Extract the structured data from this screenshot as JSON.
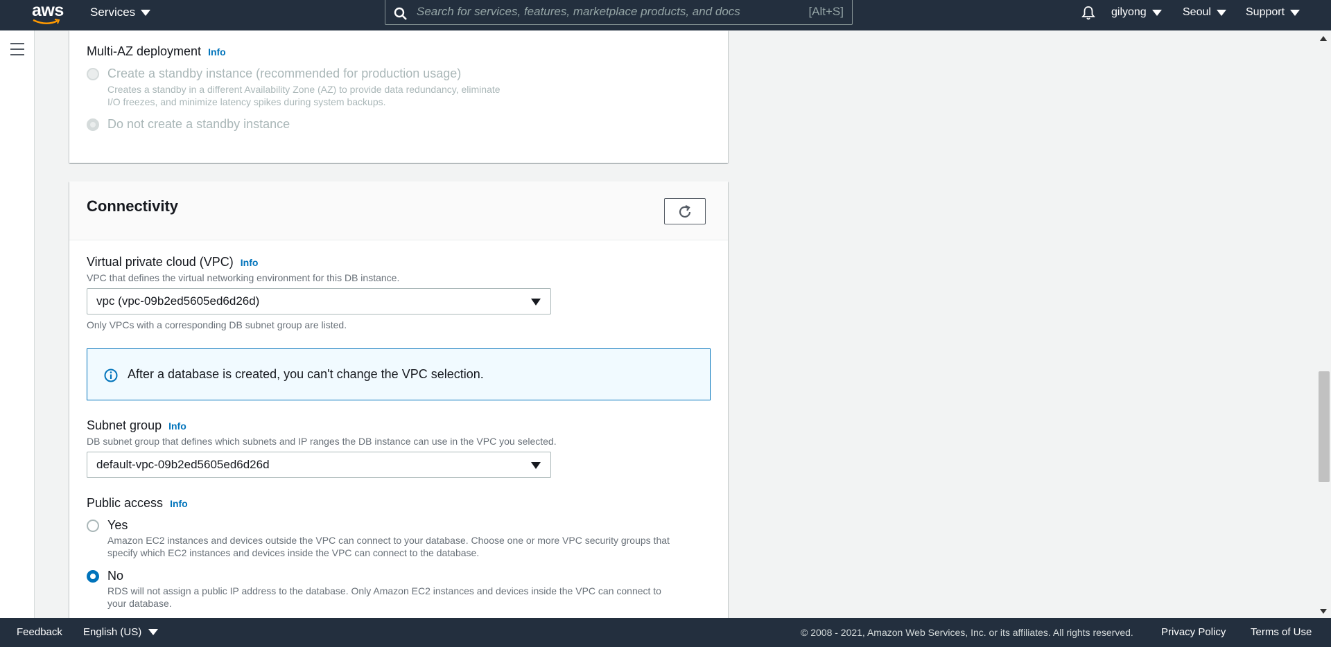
{
  "topnav": {
    "logo_text": "aws",
    "services_label": "Services",
    "search_placeholder": "Search for services, features, marketplace products, and docs",
    "search_shortcut": "[Alt+S]",
    "user": "gilyong",
    "region": "Seoul",
    "support": "Support"
  },
  "multi_az": {
    "label": "Multi-AZ deployment",
    "info": "Info",
    "option_standby": "Create a standby instance (recommended for production usage)",
    "option_standby_desc_1": "Creates a standby in a different Availability Zone (AZ) to provide data redundancy, eliminate",
    "option_standby_desc_2": "I/O freezes, and minimize latency spikes during system backups.",
    "option_no_standby": "Do not create a standby instance"
  },
  "connectivity": {
    "title": "Connectivity",
    "vpc": {
      "label": "Virtual private cloud (VPC)",
      "info": "Info",
      "description": "VPC that defines the virtual networking environment for this DB instance.",
      "value": "vpc (vpc-09b2ed5605ed6d26d)",
      "hint": "Only VPCs with a corresponding DB subnet group are listed."
    },
    "alert": "After a database is created, you can't change the VPC selection.",
    "subnet": {
      "label": "Subnet group",
      "info": "Info",
      "description": "DB subnet group that defines which subnets and IP ranges the DB instance can use in the VPC you selected.",
      "value": "default-vpc-09b2ed5605ed6d26d"
    },
    "public_access": {
      "label": "Public access",
      "info": "Info",
      "yes_label": "Yes",
      "yes_desc_1": "Amazon EC2 instances and devices outside the VPC can connect to your database. Choose one or more VPC security groups that",
      "yes_desc_2": "specify which EC2 instances and devices inside the VPC can connect to the database.",
      "no_label": "No",
      "no_desc_1": "RDS will not assign a public IP address to the database. Only Amazon EC2 instances and devices inside the VPC can connect to",
      "no_desc_2": "your database.",
      "selected": "No"
    }
  },
  "footer": {
    "feedback": "Feedback",
    "language": "English (US)",
    "copyright": "© 2008 - 2021, Amazon Web Services, Inc. or its affiliates. All rights reserved.",
    "privacy": "Privacy Policy",
    "terms": "Terms of Use"
  },
  "colors": {
    "nav_bg": "#232f3e",
    "link_blue": "#0073bb",
    "alert_bg": "#f1faff"
  }
}
